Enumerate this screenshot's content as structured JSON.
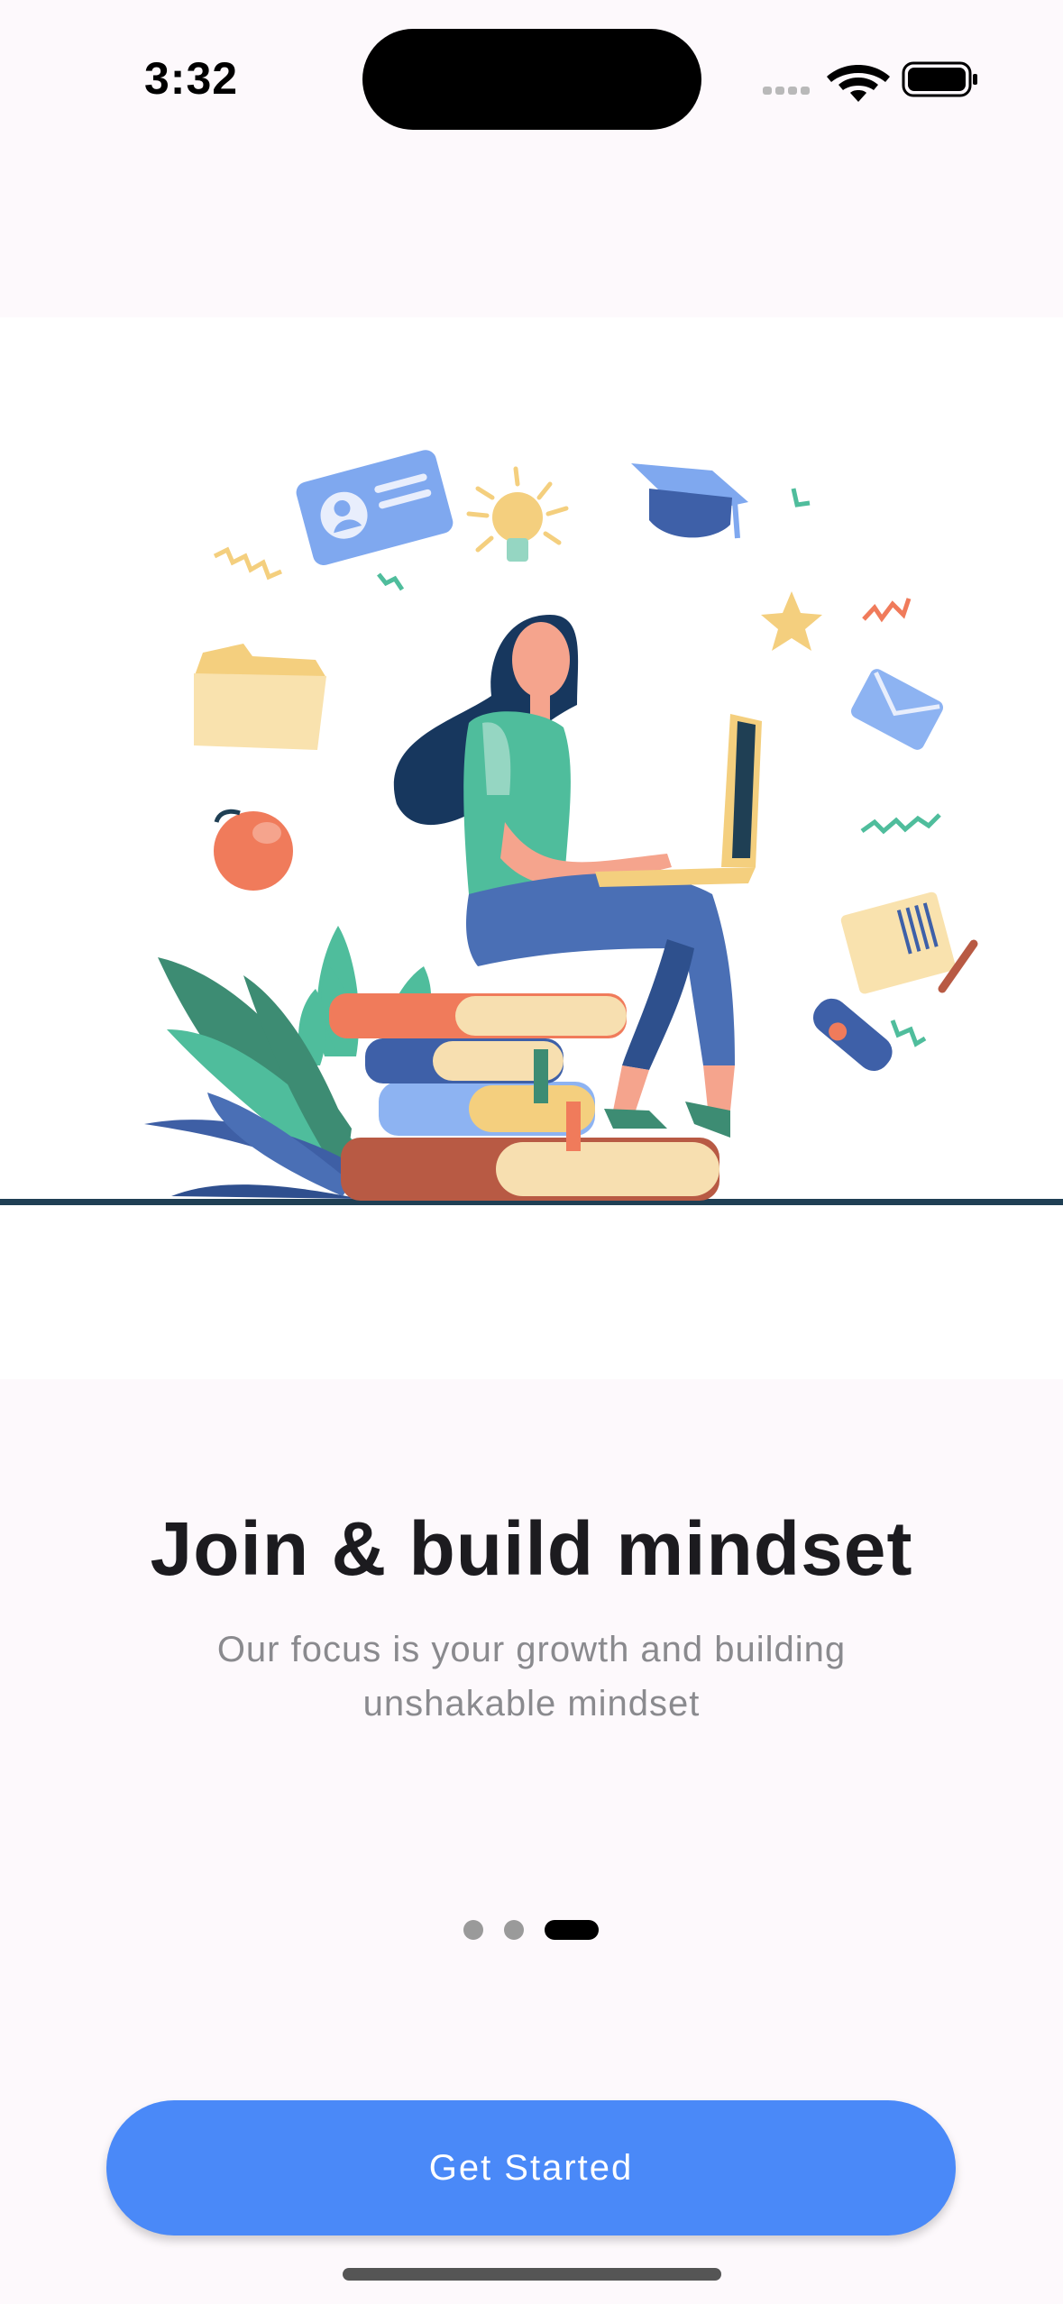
{
  "status_bar": {
    "time": "3:32",
    "icons": [
      "cellular-signal-icon",
      "wifi-icon",
      "battery-icon"
    ]
  },
  "onboarding": {
    "title": "Join & build mindset",
    "subtitle": "Our focus is your growth and building unshakable mindset",
    "page_indicator": {
      "total": 3,
      "current": 3
    },
    "cta_label": "Get Started"
  },
  "colors": {
    "background": "#fdf9fc",
    "accent": "#4a89f8",
    "title": "#1c1b1f",
    "subtitle": "#8a8a8e",
    "dot_inactive": "#9a9a9a",
    "dot_active": "#000000"
  }
}
